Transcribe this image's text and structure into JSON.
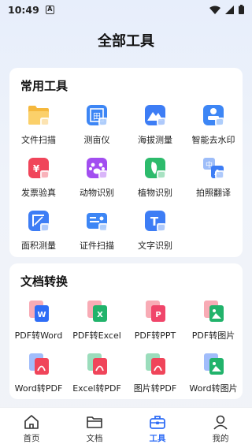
{
  "status": {
    "time": "10:49",
    "app_badge": "A"
  },
  "header": {
    "title": "全部工具"
  },
  "sections": [
    {
      "title": "常用工具",
      "items": [
        {
          "label": "文件扫描",
          "icon": "file-scan-icon",
          "color": "#f5b83d"
        },
        {
          "label": "测亩仪",
          "icon": "field-measure-icon",
          "color": "#3d86f5"
        },
        {
          "label": "海拔测量",
          "icon": "altitude-icon",
          "color": "#3d7df5"
        },
        {
          "label": "智能去水印",
          "icon": "watermark-remove-icon",
          "color": "#3d86f5"
        },
        {
          "label": "发票验真",
          "icon": "invoice-icon",
          "color": "#f0455a"
        },
        {
          "label": "动物识别",
          "icon": "animal-icon",
          "color": "#a24ef0"
        },
        {
          "label": "植物识别",
          "icon": "plant-icon",
          "color": "#2dbb6c"
        },
        {
          "label": "拍照翻译",
          "icon": "translate-icon",
          "color": "#3d7df5"
        },
        {
          "label": "面积测量",
          "icon": "area-measure-icon",
          "color": "#3d7df5"
        },
        {
          "label": "证件扫描",
          "icon": "id-scan-icon",
          "color": "#3d86f5"
        },
        {
          "label": "文字识别",
          "icon": "text-ocr-icon",
          "color": "#3d7df5"
        }
      ]
    },
    {
      "title": "文档转换",
      "items": [
        {
          "label": "PDF转Word",
          "icon": "pdf-to-word-icon",
          "from": "#f0455a",
          "to": "#2f6df6",
          "glyph": "W"
        },
        {
          "label": "PDF转Excel",
          "icon": "pdf-to-excel-icon",
          "from": "#f0455a",
          "to": "#21b36b",
          "glyph": "X"
        },
        {
          "label": "PDF转PPT",
          "icon": "pdf-to-ppt-icon",
          "from": "#f0455a",
          "to": "#f0456a",
          "glyph": "P"
        },
        {
          "label": "PDF转图片",
          "icon": "pdf-to-image-icon",
          "from": "#f0455a",
          "to": "#21b36b",
          "glyph": ""
        },
        {
          "label": "Word转PDF",
          "icon": "word-to-pdf-icon",
          "from": "#2f6df6",
          "to": "#f0455a",
          "glyph": ""
        },
        {
          "label": "Excel转PDF",
          "icon": "excel-to-pdf-icon",
          "from": "#21b36b",
          "to": "#f0455a",
          "glyph": ""
        },
        {
          "label": "图片转PDF",
          "icon": "image-to-pdf-icon",
          "from": "#21b36b",
          "to": "#f0455a",
          "glyph": ""
        },
        {
          "label": "Word转图片",
          "icon": "word-to-image-icon",
          "from": "#2f6df6",
          "to": "#21b36b",
          "glyph": ""
        }
      ]
    }
  ],
  "tabbar": [
    {
      "label": "首页",
      "icon": "home-icon",
      "active": false
    },
    {
      "label": "文档",
      "icon": "folder-icon",
      "active": false
    },
    {
      "label": "工具",
      "icon": "toolbox-icon",
      "active": true
    },
    {
      "label": "我的",
      "icon": "profile-icon",
      "active": false
    }
  ],
  "colors": {
    "accent": "#2f6df6"
  }
}
